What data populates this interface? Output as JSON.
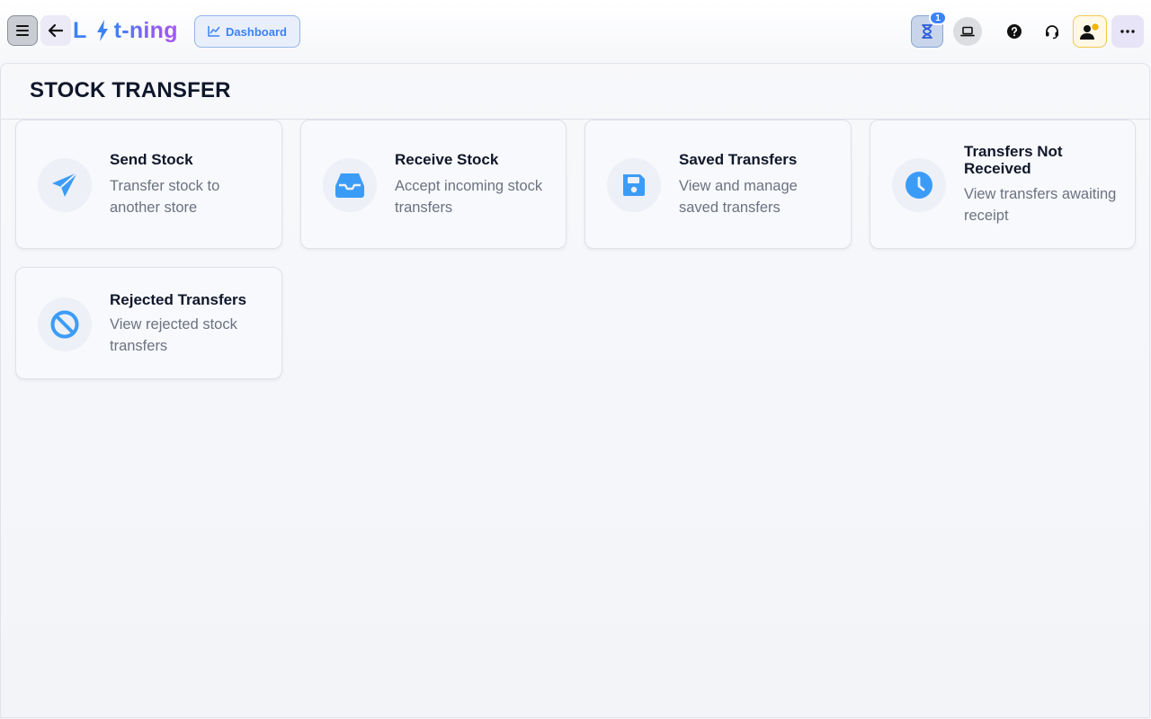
{
  "header": {
    "logo": {
      "part1": "L",
      "part2": "t-ning"
    },
    "dashboard_label": "Dashboard",
    "timer_badge": "1"
  },
  "page": {
    "title": "STOCK TRANSFER"
  },
  "cards": [
    {
      "title": "Send Stock",
      "desc": "Transfer stock to another store",
      "icon": "paper-plane-icon"
    },
    {
      "title": "Receive Stock",
      "desc": "Accept incoming stock transfers",
      "icon": "inbox-icon"
    },
    {
      "title": "Saved Transfers",
      "desc": "View and manage saved transfers",
      "icon": "floppy-disk-icon"
    },
    {
      "title": "Transfers Not Received",
      "desc": "View transfers awaiting receipt",
      "icon": "clock-icon"
    },
    {
      "title": "Rejected Transfers",
      "desc": "View rejected stock transfers",
      "icon": "ban-icon"
    }
  ],
  "colors": {
    "accent": "#3b82f6",
    "purple": "#a855f7",
    "title": "#0f172a",
    "muted": "#6b7280"
  }
}
